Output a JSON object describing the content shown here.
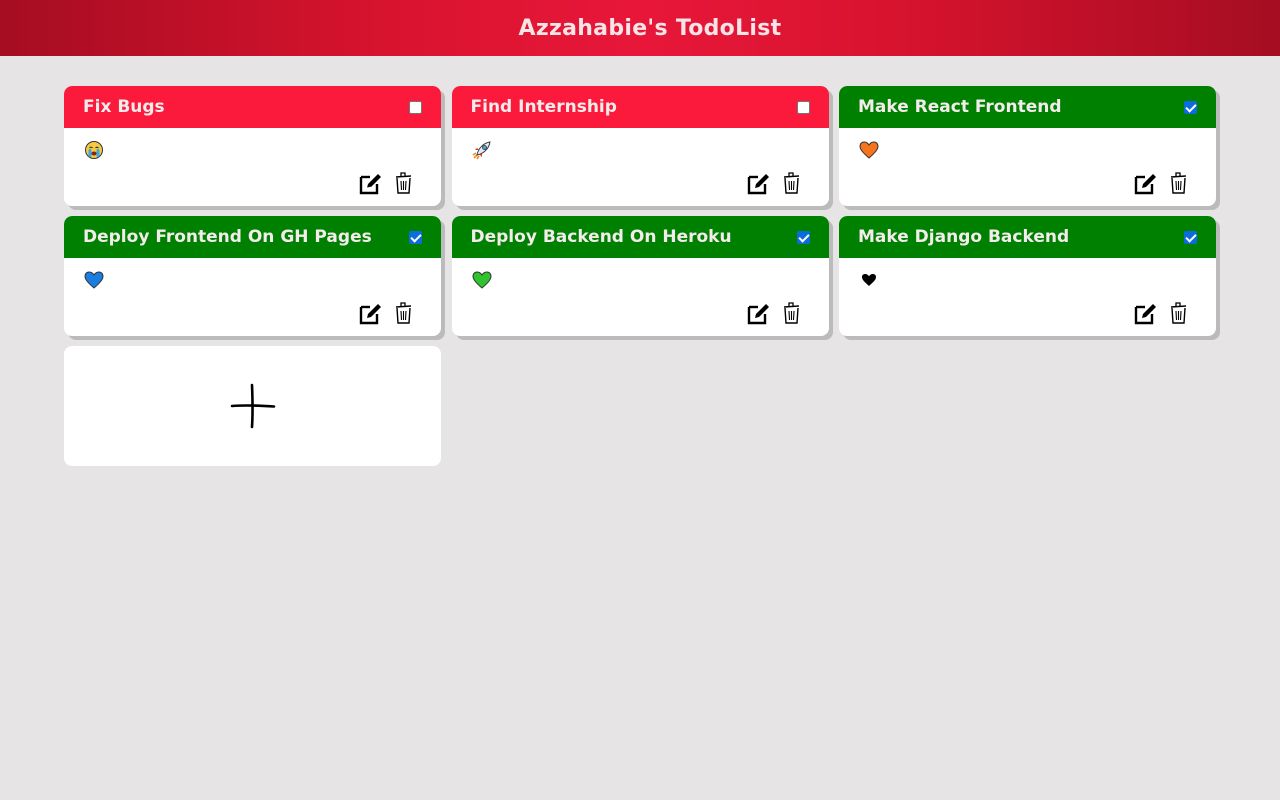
{
  "header": {
    "title": "Azzahabie's TodoList"
  },
  "todos": [
    {
      "title": "Fix Bugs",
      "completed": false,
      "emoji": "crying-face-icon"
    },
    {
      "title": "Find Internship",
      "completed": false,
      "emoji": "rocket-icon"
    },
    {
      "title": "Make React Frontend",
      "completed": true,
      "emoji": "orange-heart-icon"
    },
    {
      "title": "Deploy Frontend On GH Pages",
      "completed": true,
      "emoji": "blue-heart-icon"
    },
    {
      "title": "Deploy Backend On Heroku",
      "completed": true,
      "emoji": "green-heart-icon"
    },
    {
      "title": "Make Django Backend",
      "completed": true,
      "emoji": "black-heart-icon"
    }
  ],
  "colors": {
    "header_gradient_center": "#e8173a",
    "header_gradient_edge": "#a50d22",
    "pending": "#fb1a3c",
    "done": "#008000",
    "background": "#e6e4e5"
  },
  "add_card": {
    "icon": "plus-icon"
  }
}
